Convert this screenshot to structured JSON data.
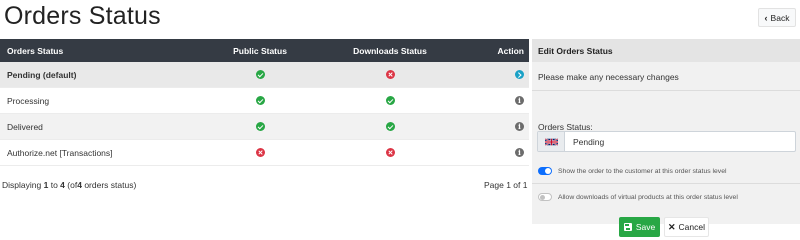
{
  "page": {
    "title": "Orders Status",
    "back_label": "Back"
  },
  "table": {
    "headers": {
      "name": "Orders Status",
      "public": "Public Status",
      "downloads": "Downloads Status",
      "action": "Action"
    },
    "rows": [
      {
        "name": "Pending (default)",
        "public": "yes",
        "downloads": "no",
        "action": "select",
        "selected": true
      },
      {
        "name": "Processing",
        "public": "yes",
        "downloads": "yes",
        "action": "info",
        "selected": false
      },
      {
        "name": "Delivered",
        "public": "yes",
        "downloads": "yes",
        "action": "info",
        "selected": false
      },
      {
        "name": "Authorize.net [Transactions]",
        "public": "no",
        "downloads": "no",
        "action": "info",
        "selected": false
      }
    ],
    "footer": {
      "displaying_prefix": "Displaying",
      "from": "1",
      "to_word": "to",
      "to": "4",
      "of_prefix": "(of",
      "total": "4",
      "of_suffix": "orders status)",
      "page_info": "Page 1 of 1"
    }
  },
  "edit_panel": {
    "title": "Edit Orders Status",
    "intro": "Please make any necessary changes",
    "status_label": "Orders Status:",
    "status_value": "Pending",
    "language_flag": "uk-flag-icon",
    "toggle_public_label": "Show the order to the customer at this order status level",
    "toggle_public_on": true,
    "toggle_downloads_label": "Allow downloads of virtual products at this order status level",
    "toggle_downloads_on": false,
    "save_label": "Save",
    "cancel_label": "Cancel"
  },
  "colors": {
    "header_bg": "#353b44",
    "success": "#28a745",
    "danger": "#dc3545",
    "info": "#1aa1c6",
    "toggle_on": "#0d6efd"
  }
}
